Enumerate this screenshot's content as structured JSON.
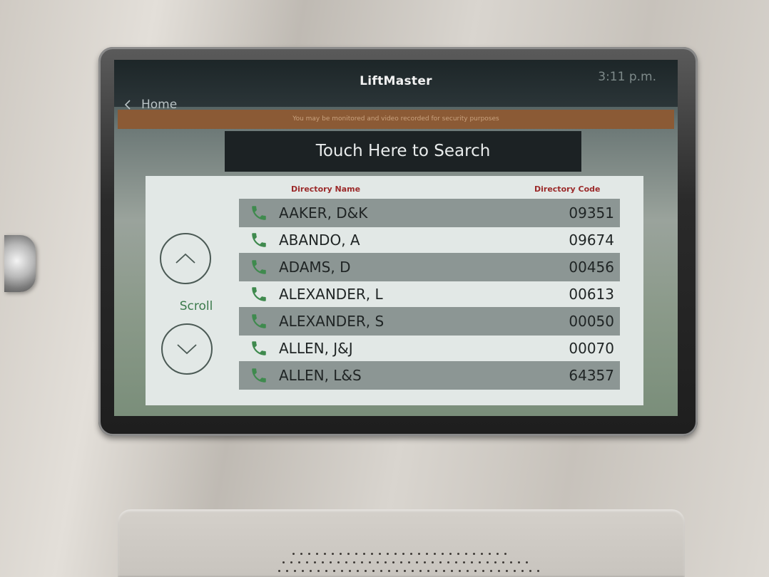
{
  "header": {
    "brand": "LiftMaster",
    "time": "3:11 p.m.",
    "back_label": "Home"
  },
  "notice": "You may be monitored and video recorded for security purposes",
  "search": {
    "label": "Touch Here to Search"
  },
  "directory": {
    "name_header": "Directory Name",
    "code_header": "Directory Code",
    "scroll_label": "Scroll",
    "entries": [
      {
        "name": "AAKER, D&K",
        "code": "09351"
      },
      {
        "name": "ABANDO, A",
        "code": "09674"
      },
      {
        "name": "ADAMS, D",
        "code": "00456"
      },
      {
        "name": "ALEXANDER, L",
        "code": "00613"
      },
      {
        "name": "ALEXANDER, S",
        "code": "00050"
      },
      {
        "name": "ALLEN, J&J",
        "code": "00070"
      },
      {
        "name": "ALLEN, L&S",
        "code": "64357"
      }
    ]
  },
  "colors": {
    "notice_bg": "#8b5a35",
    "header_accent": "#9b2a2a",
    "phone_icon": "#3f8a4e",
    "scroll_text": "#3c7a4c"
  },
  "icons": {
    "back": "chevron-left-icon",
    "scroll_up": "chevron-up-icon",
    "scroll_down": "chevron-down-icon",
    "call": "phone-icon"
  }
}
